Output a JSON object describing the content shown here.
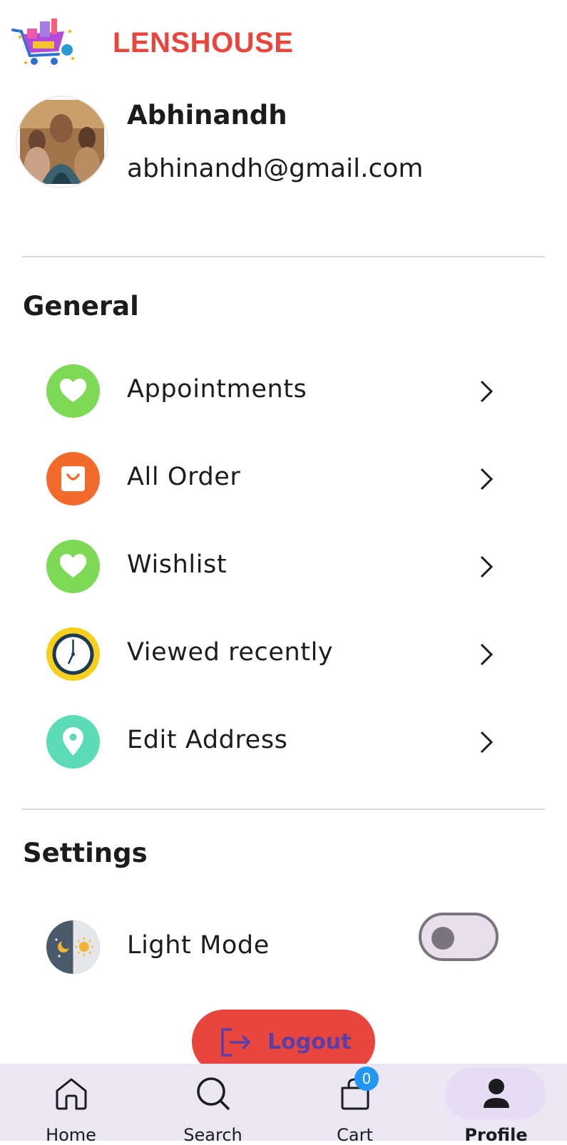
{
  "header": {
    "brand": "LENSHOUSE",
    "logo_icon": "shopping-cart-logo"
  },
  "profile": {
    "name": "Abhinandh",
    "email": "abhinandh@gmail.com"
  },
  "general": {
    "title": "General",
    "items": [
      {
        "label": "Appointments",
        "icon": "heart-icon",
        "color": "#7ed957"
      },
      {
        "label": "All Order",
        "icon": "shopping-bag-icon",
        "color": "#f26b2a"
      },
      {
        "label": "Wishlist",
        "icon": "heart-icon",
        "color": "#7ed957"
      },
      {
        "label": "Viewed recently",
        "icon": "clock-icon",
        "color": "#f7cf1d"
      },
      {
        "label": "Edit Address",
        "icon": "location-pin-icon",
        "color": "#5bdbb6"
      }
    ]
  },
  "settings": {
    "title": "Settings",
    "light_mode": {
      "label": "Light Mode",
      "icon": "day-night-icon",
      "enabled": false
    }
  },
  "logout": {
    "label": "Logout",
    "color": "#e8453c"
  },
  "bottom_nav": {
    "items": [
      {
        "label": "Home",
        "icon": "home-icon"
      },
      {
        "label": "Search",
        "icon": "search-icon"
      },
      {
        "label": "Cart",
        "icon": "shopping-bag-icon"
      },
      {
        "label": "Profile",
        "icon": "person-icon",
        "active": true
      }
    ],
    "cart_badge": "0"
  }
}
